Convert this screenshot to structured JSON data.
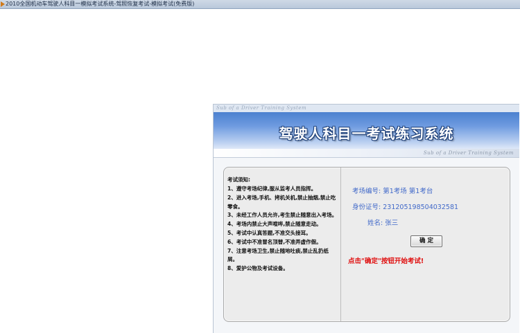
{
  "window": {
    "title": "2010全国机动车驾驶人科目一模拟考试系统-驾照恢复考试-模拟考试(免费版)"
  },
  "header": {
    "top_strip_text": "Sub of a Driver Training System",
    "banner_title": "驾驶人科目一考试练习系统",
    "sub_strip_text": "Sub of a Driver Training System"
  },
  "rules": {
    "title": "考试须知:",
    "items": [
      "1、遵守考场纪律,服从监考人员指挥。",
      "2、进入考场,手机、拷机关机,禁止抽烟,禁止吃零食。",
      "3、未经工作人员允许,考生禁止随意出入考场。",
      "4、考场内禁止大声喧哗,禁止随意走动。",
      "5、考试中认真答题,不准交头接耳。",
      "6、考试中不准冒名顶替,不准弄虚作假。",
      "7、注意考场卫生,禁止随地吐痰,禁止乱扔纸屑。",
      "8、爱护公物及考试设备。"
    ]
  },
  "exam_info": {
    "room_label": "考场编号:",
    "room_value": "第1考场 第1考台",
    "id_label": "身份证号:",
    "id_value": "231205198504032581",
    "name_label": "姓名:",
    "name_value": "张三"
  },
  "confirm_button_label": "确 定",
  "hint_text": "点击\"确定\"按钮开始考试!"
}
